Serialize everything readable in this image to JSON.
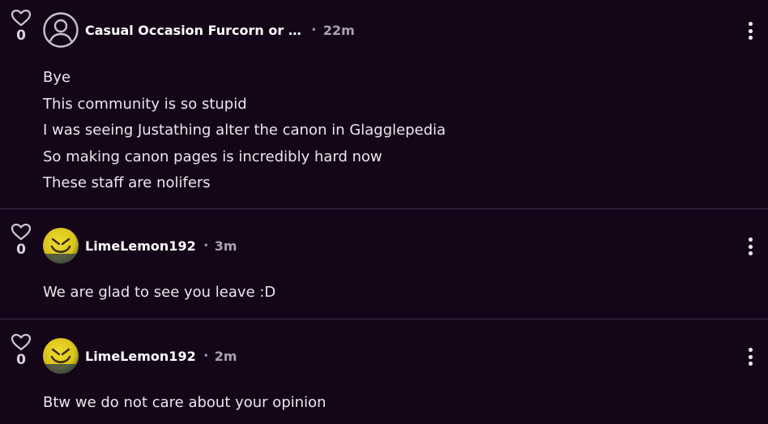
{
  "comments": [
    {
      "likes": "0",
      "author": "Casual Occasion Furcorn or …",
      "time": "22m",
      "avatar_icon": "default-user-icon",
      "lines": [
        "Bye",
        "This community is so stupid",
        "I was seeing Justathing alter the canon in Glagglepedia",
        "So making canon pages is incredibly hard now",
        "These staff are nolifers"
      ]
    },
    {
      "likes": "0",
      "author": "LimeLemon192",
      "time": "3m",
      "avatar_icon": "yellow-smiley-avatar",
      "lines": [
        "We are glad to see you leave :D"
      ]
    },
    {
      "likes": "0",
      "author": "LimeLemon192",
      "time": "2m",
      "avatar_icon": "yellow-smiley-avatar",
      "lines": [
        "Btw we do not care about your opinion"
      ]
    }
  ],
  "separator": "•",
  "colors": {
    "background": "#140519",
    "divider": "#3d3046",
    "text": "#ebe6ee",
    "muted": "#aaa2b0"
  }
}
